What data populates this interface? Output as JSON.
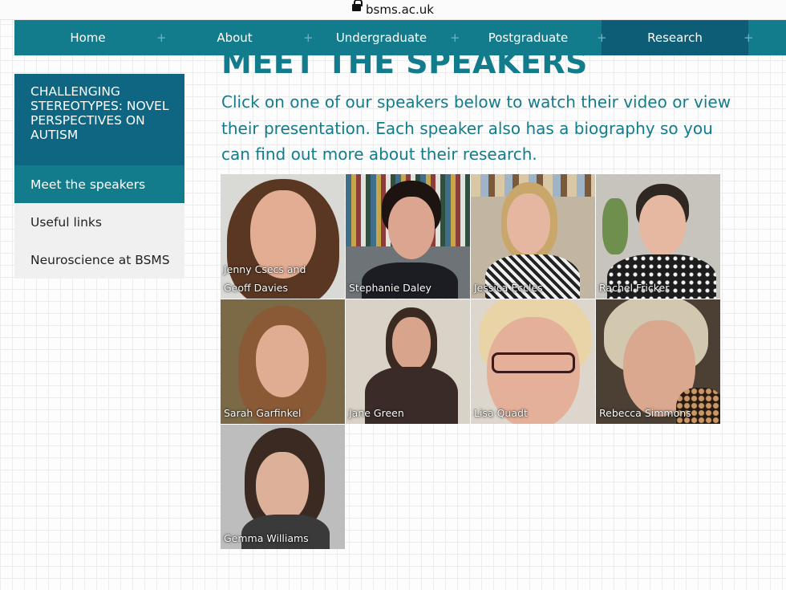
{
  "browser": {
    "url": "bsms.ac.uk"
  },
  "nav": {
    "items": [
      {
        "label": "Home"
      },
      {
        "label": "About"
      },
      {
        "label": "Undergraduate"
      },
      {
        "label": "Postgraduate"
      },
      {
        "label": "Research"
      }
    ],
    "active": "Research"
  },
  "sidebar": {
    "heading": "CHALLENGING STEREOTYPES: NOVEL PERSPECTIVES ON AUTISM",
    "items": [
      {
        "label": "Meet the speakers",
        "active": true
      },
      {
        "label": "Useful links",
        "active": false
      },
      {
        "label": "Neuroscience at BSMS",
        "active": false
      }
    ]
  },
  "main": {
    "title": "MEET THE SPEAKERS",
    "intro": "Click on one of our speakers below to watch their video or view their presentation. Each speaker also has a biography so you can find out more about their research."
  },
  "speakers": [
    {
      "name": "Jenny Csecs and Geoff Davies"
    },
    {
      "name": "Stephanie Daley"
    },
    {
      "name": "Jessica Eccles"
    },
    {
      "name": "Rachel Fricker"
    },
    {
      "name": "Sarah Garfinkel"
    },
    {
      "name": "Jane Green"
    },
    {
      "name": "Lisa Quadt"
    },
    {
      "name": "Rebecca Simmons"
    },
    {
      "name": "Gemma Williams"
    }
  ],
  "colors": {
    "brand_teal": "#127c8d",
    "brand_dark": "#0e5d77",
    "sidebar_heading": "#0f6683"
  }
}
